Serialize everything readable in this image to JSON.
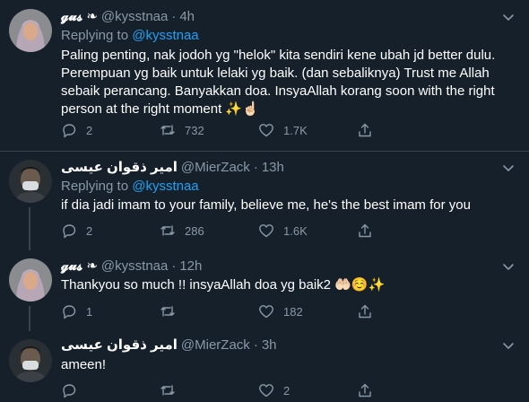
{
  "tweets": [
    {
      "name": "𝓰𝓾𝓼 ❧",
      "handle": "@kysstnaa",
      "dot": "·",
      "time": "4h",
      "replying_prefix": "Replying to",
      "replying_to": "@kysstnaa",
      "body": "Paling penting, nak jodoh yg \"helok\" kita sendiri kene ubah jd better dulu. Perempuan yg baik untuk lelaki yg baik. (dan sebaliknya) Trust me Allah sebaik perancang. Banyakkan doa. InsyaAllah korang soon with the right person at the right moment ✨☝🏻",
      "replies": "2",
      "retweets": "732",
      "likes": "1.7K",
      "avatar": "woman-hijab-avatar"
    },
    {
      "name": "امير ذقوان عيسى",
      "handle": "@MierZack",
      "dot": "·",
      "time": "13h",
      "replying_prefix": "Replying to",
      "replying_to": "@kysstnaa",
      "body": "if dia jadi imam to your family, believe me, he's the best imam for you",
      "replies": "2",
      "retweets": "286",
      "likes": "1.6K",
      "avatar": "man-mask-avatar"
    },
    {
      "name": "𝓰𝓾𝓼 ❧",
      "handle": "@kysstnaa",
      "dot": "·",
      "time": "12h",
      "body": "Thankyou so much !! insyaAllah doa yg baik2 🤲🏻☺️✨",
      "replies": "1",
      "retweets": "",
      "likes": "182",
      "avatar": "woman-hijab-avatar"
    },
    {
      "name": "امير ذقوان عيسى",
      "handle": "@MierZack",
      "dot": "·",
      "time": "3h",
      "body": "ameen!",
      "replies": "",
      "retweets": "",
      "likes": "2",
      "avatar": "man-mask-avatar"
    }
  ],
  "colors": {
    "background": "#15202b",
    "secondary_text": "#8899a6",
    "link": "#1da1f2",
    "divider": "#38444d"
  }
}
